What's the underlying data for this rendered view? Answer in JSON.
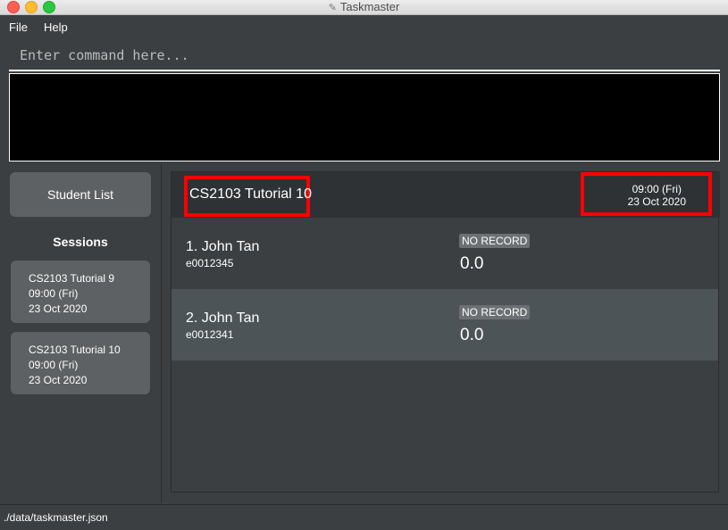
{
  "window": {
    "title": "Taskmaster"
  },
  "menu": {
    "file": "File",
    "help": "Help"
  },
  "command": {
    "placeholder": "Enter command here...",
    "value": ""
  },
  "result": {
    "text": ""
  },
  "sidebar": {
    "student_list_button": "Student List",
    "sessions_title": "Sessions",
    "sessions": [
      {
        "name": "CS2103 Tutorial 9",
        "time": "09:00 (Fri)",
        "date": "23 Oct 2020"
      },
      {
        "name": "CS2103 Tutorial 10",
        "time": "09:00 (Fri)",
        "date": "23 Oct 2020"
      }
    ]
  },
  "session": {
    "name": "CS2103 Tutorial 10",
    "time": "09:00 (Fri)",
    "date": "23 Oct 2020",
    "highlight_color": "#ff0000"
  },
  "records": [
    {
      "index_name": "1.  John Tan",
      "id": "e0012345",
      "status": "NO RECORD",
      "score": "0.0"
    },
    {
      "index_name": "2.  John Tan",
      "id": "e0012341",
      "status": "NO RECORD",
      "score": "0.0"
    }
  ],
  "status_bar": {
    "path": "./data/taskmaster.json"
  }
}
